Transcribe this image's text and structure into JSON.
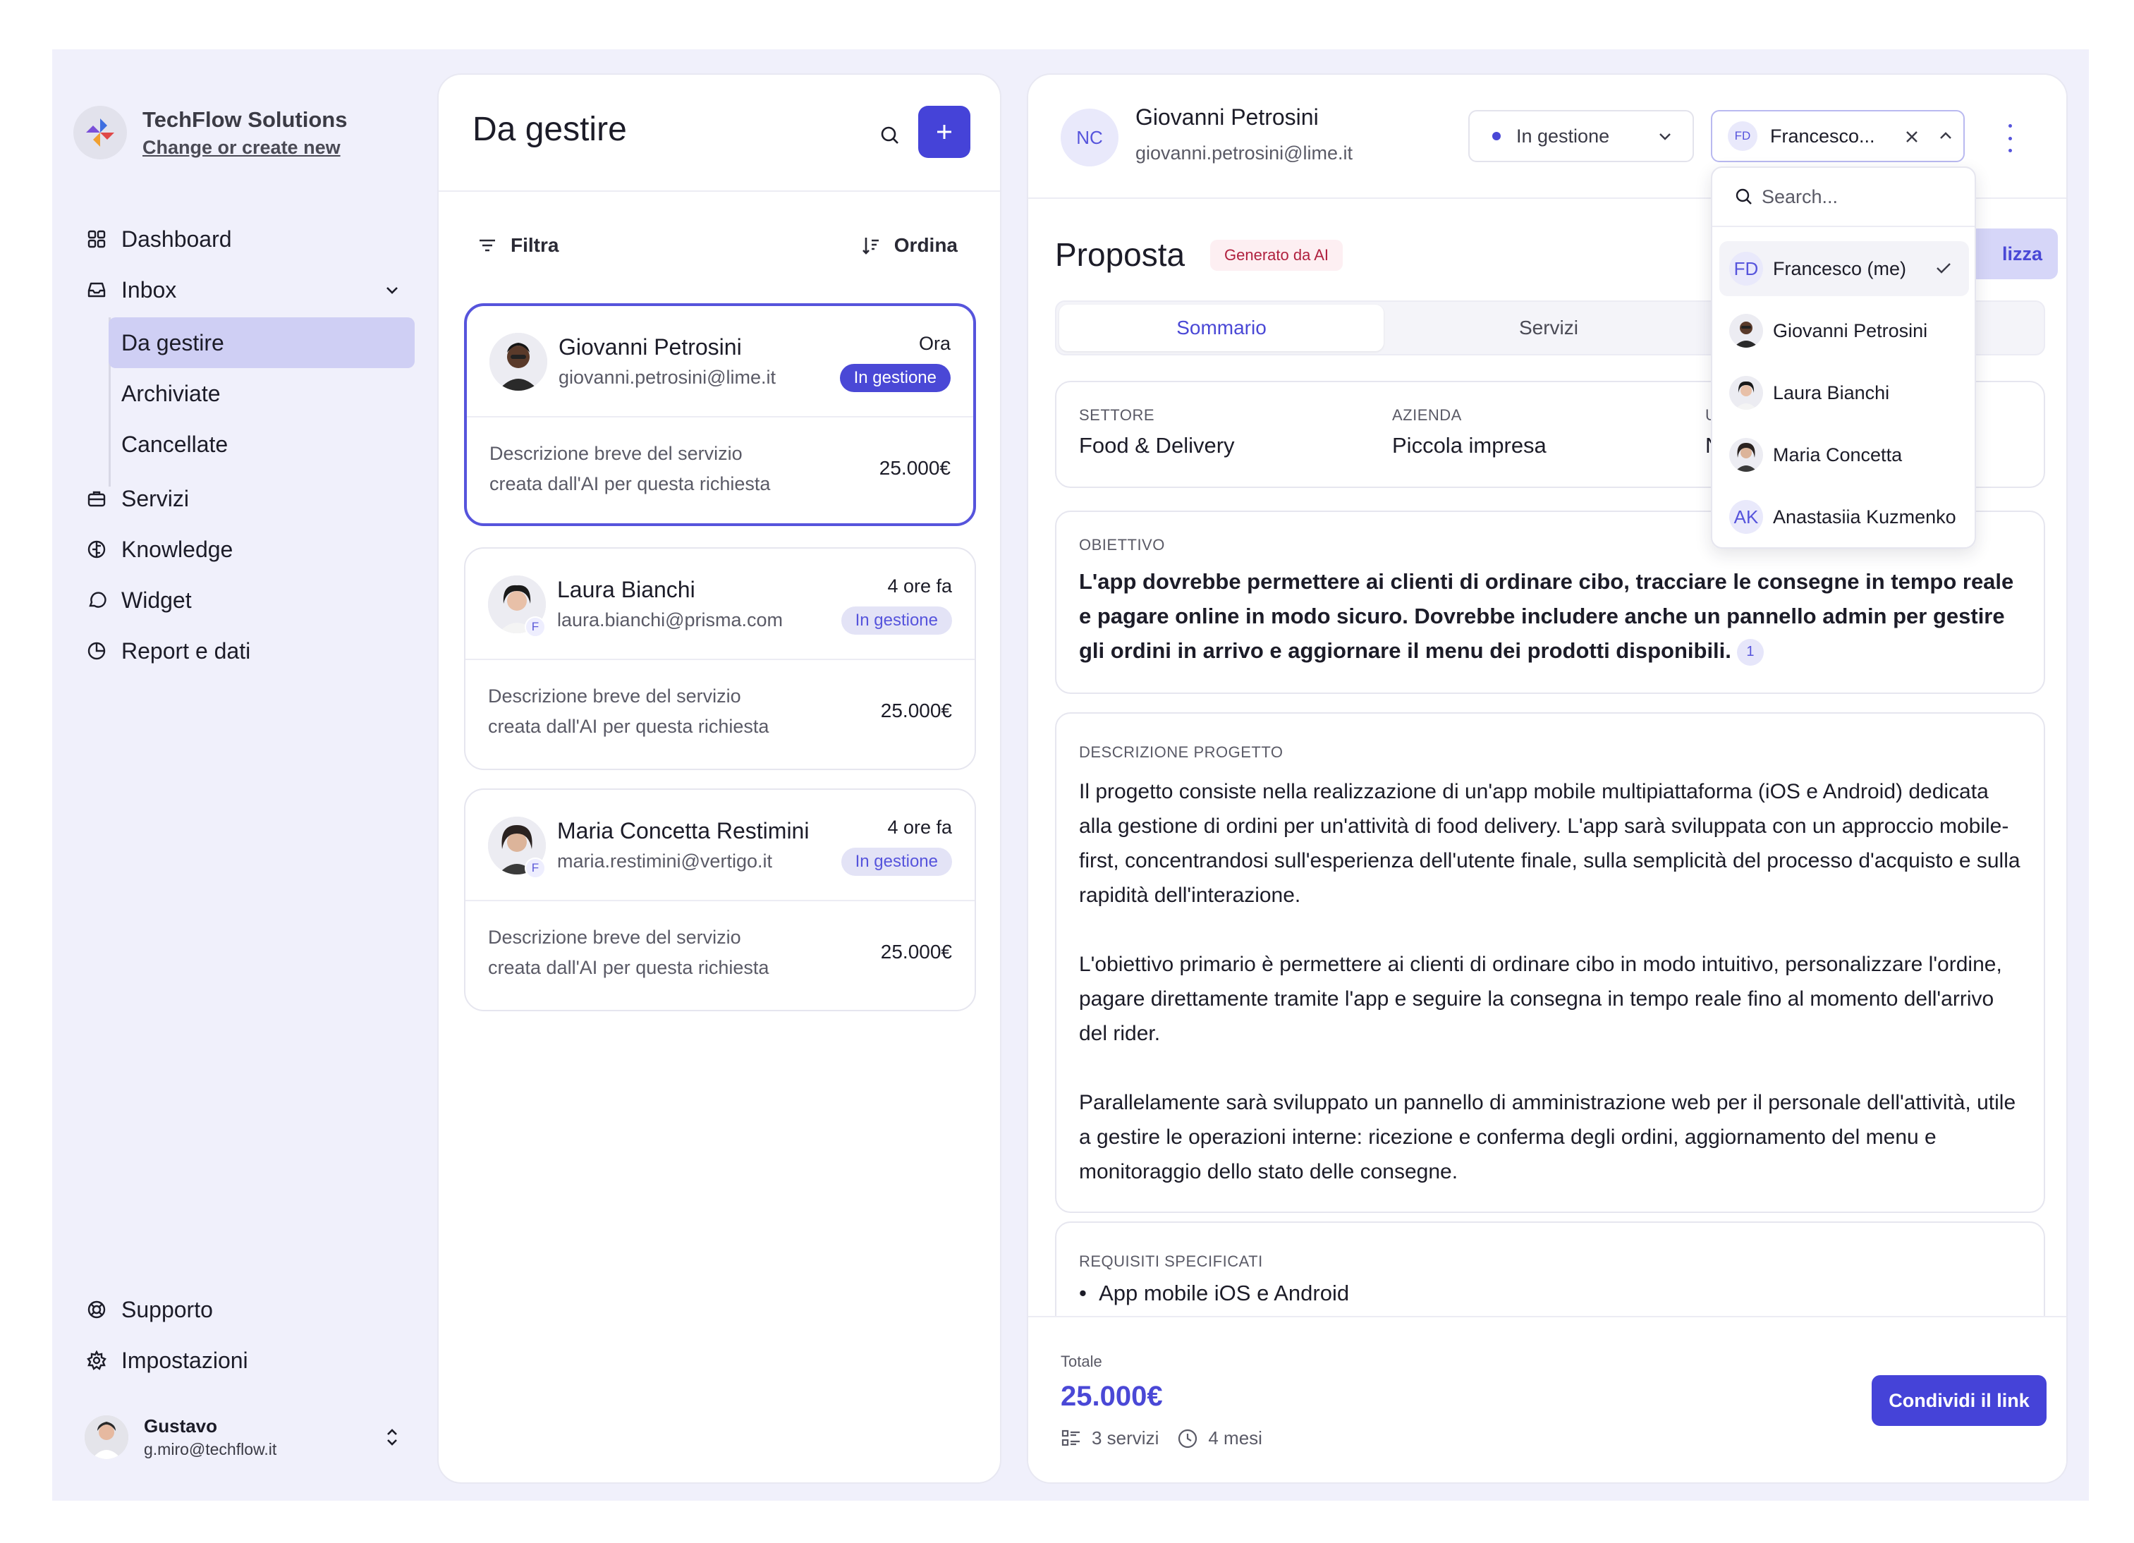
{
  "brand": {
    "name": "TechFlow Solutions",
    "link": "Change or create new",
    "logo_icon": "techflow-logo"
  },
  "sidebar": {
    "items": [
      {
        "label": "Dashboard",
        "icon": "dashboard-grid-icon"
      },
      {
        "label": "Inbox",
        "icon": "inbox-tray-icon"
      },
      {
        "label": "Servizi",
        "icon": "briefcase-icon"
      },
      {
        "label": "Knowledge",
        "icon": "brain-icon"
      },
      {
        "label": "Widget",
        "icon": "chat-bubble-icon"
      },
      {
        "label": "Report e dati",
        "icon": "pie-chart-icon"
      }
    ],
    "inbox_sub": [
      "Da gestire",
      "Archiviate",
      "Cancellate"
    ],
    "bottom": [
      {
        "label": "Supporto",
        "icon": "lifebuoy-icon"
      },
      {
        "label": "Impostazioni",
        "icon": "gear-icon"
      }
    ],
    "user": {
      "name": "Gustavo",
      "email": "g.miro@techflow.it"
    }
  },
  "list": {
    "title": "Da gestire",
    "filter_label": "Filtra",
    "order_label": "Ordina",
    "cards": [
      {
        "name": "Giovanni Petrosini",
        "email": "giovanni.petrosini@lime.it",
        "time": "Ora",
        "status": "In gestione",
        "desc_line1": "Descrizione breve del servizio",
        "desc_line2": "creata dall'AI per questa richiesta",
        "price": "25.000€"
      },
      {
        "name": "Laura Bianchi",
        "email": "laura.bianchi@prisma.com",
        "time": "4 ore fa",
        "status": "In gestione",
        "badge": "F",
        "desc_line1": "Descrizione breve del servizio",
        "desc_line2": "creata dall'AI per questa richiesta",
        "price": "25.000€"
      },
      {
        "name": "Maria Concetta Restimini",
        "email": "maria.restimini@vertigo.it",
        "time": "4 ore fa",
        "status": "In gestione",
        "badge": "F",
        "desc_line1": "Descrizione breve del servizio",
        "desc_line2": "creata dall'AI per questa richiesta",
        "price": "25.000€"
      }
    ]
  },
  "detail": {
    "initials": "NC",
    "name": "Giovanni Petrosini",
    "email": "giovanni.petrosini@lime.it",
    "status_value": "In gestione",
    "assignee_initials": "FD",
    "assignee_value": "Francesco...",
    "proposal_title": "Proposta",
    "ai_badge": "Generato da AI",
    "finalize_label": "lizza",
    "tabs": [
      "Sommario",
      "Servizi"
    ],
    "meta": [
      {
        "label": "SETTORE",
        "value": "Food & Delivery"
      },
      {
        "label": "AZIENDA",
        "value": "Piccola impresa"
      },
      {
        "label": "U",
        "value": "N"
      }
    ],
    "objective_label": "OBIETTIVO",
    "objective_text": "L'app dovrebbe permettere ai clienti di ordinare cibo, tracciare le consegne in tempo reale e pagare online in modo sicuro. Dovrebbe includere anche un pannello admin per gestire gli ordini in arrivo e aggiornare il menu dei prodotti disponibili.",
    "objective_ref": "1",
    "desc_label": "DESCRIZIONE PROGETTO",
    "desc_p1": "Il progetto consiste nella realizzazione di un'app mobile multipiattaforma (iOS e Android) dedicata alla gestione di ordini per un'attività di food delivery. L'app sarà sviluppata con un approccio mobile-first, concentrandosi sull'esperienza dell'utente finale, sulla semplicità del processo d'acquisto e sulla rapidità dell'interazione.",
    "desc_p2": "L'obiettivo primario è permettere ai clienti di ordinare cibo in modo intuitivo, personalizzare l'ordine, pagare direttamente tramite l'app e seguire la consegna in tempo reale fino al momento dell'arrivo del rider.",
    "desc_p3": "Parallelamente sarà sviluppato un pannello di amministrazione web per il personale dell'attività, utile a gestire le operazioni interne: ricezione e conferma degli ordini, aggiornamento del menu e monitoraggio dello stato delle consegne.",
    "req_label": "REQUISITI SPECIFICATI",
    "req_first": "App mobile iOS e Android",
    "total_label": "Totale",
    "total_value": "25.000€",
    "services_count": "3 servizi",
    "duration": "4 mesi",
    "share_label": "Condividi il link"
  },
  "dropdown": {
    "search_placeholder": "Search...",
    "options": [
      {
        "label": "Francesco (me)",
        "initials": "FD",
        "selected": true
      },
      {
        "label": "Giovanni Petrosini"
      },
      {
        "label": "Laura Bianchi"
      },
      {
        "label": "Maria Concetta"
      },
      {
        "label": "Anastasiia Kuzmenko",
        "initials": "AK"
      }
    ]
  },
  "colors": {
    "accent": "#4543d8",
    "panel_bg": "#f0f0fb",
    "ai_badge": "#b0213f"
  }
}
